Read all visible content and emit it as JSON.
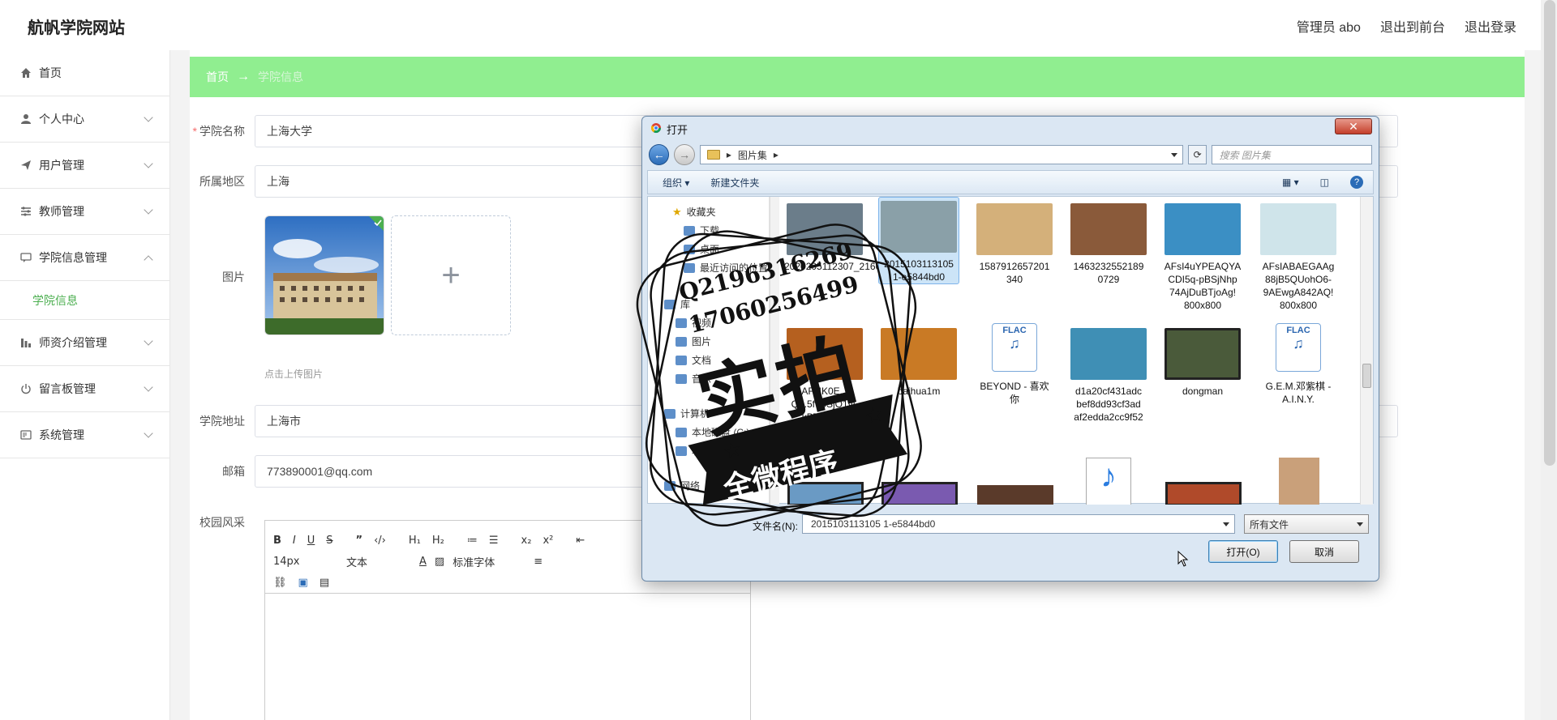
{
  "header": {
    "site_title": "航帆学院网站",
    "admin": "管理员 abo",
    "to_front": "退出到前台",
    "logout": "退出登录"
  },
  "sidebar": {
    "items": [
      {
        "label": "首页",
        "icon": "home-icon"
      },
      {
        "label": "个人中心",
        "icon": "user-icon"
      },
      {
        "label": "用户管理",
        "icon": "send-icon"
      },
      {
        "label": "教师管理",
        "icon": "sliders-icon"
      },
      {
        "label": "学院信息管理",
        "icon": "chat-icon"
      },
      {
        "label": "学院信息",
        "icon": ""
      },
      {
        "label": "师资介绍管理",
        "icon": "bar-chart-icon"
      },
      {
        "label": "留言板管理",
        "icon": "power-icon"
      },
      {
        "label": "系统管理",
        "icon": "id-card-icon"
      }
    ]
  },
  "breadcrumb": {
    "home": "首页",
    "sep": "→",
    "current": "学院信息"
  },
  "form": {
    "name_label": "学院名称",
    "name_value": "上海大学",
    "region_label": "所属地区",
    "region_value": "上海",
    "image_label": "图片",
    "upload_hint": "点击上传图片",
    "address_label": "学院地址",
    "address_value": "上海市",
    "email_label": "邮箱",
    "email_value": "773890001@qq.com",
    "campus_label": "校园风采"
  },
  "editor": {
    "font_size": "14px",
    "block": "文本",
    "font_family": "标准字体"
  },
  "dialog": {
    "title": "打开",
    "path": "图片集",
    "search_placeholder": "搜索 图片集",
    "organize": "组织 ▾",
    "new_folder": "新建文件夹",
    "tree": [
      "收藏夹",
      "下载",
      "桌面",
      "最近访问的位置",
      "库",
      "视频",
      "图片",
      "文档",
      "音乐",
      "计算机",
      "本地磁盘 (C:)",
      "软件 (D:)",
      "网络"
    ],
    "files": [
      {
        "name": "2020205112307_21604",
        "color": "#6b7d8a"
      },
      {
        "name": "2015103113105 1-e5844bd0",
        "color": "#8aa0a8",
        "selected": true
      },
      {
        "name": "1587912657201 340",
        "color": "#d4b07a"
      },
      {
        "name": "1463232552189 0729",
        "color": "#8a5a3a"
      },
      {
        "name": "AFsI4uYPEAQYA CDI5q-pBSjNhp 74AjDuBTjoAg! 800x800",
        "color": "#3b8fc4"
      },
      {
        "name": "AFsIABAEGAAg 88jB5QUohO6- 9AEwgA842AQ! 800x800",
        "color": "#cfe4ea"
      },
      {
        "name": "AFsIK0E... Q...5fvBSjO1vL kBTDIAT...",
        "color": "#b5601f"
      },
      {
        "name": "baihua1m",
        "color": "#c97a25"
      },
      {
        "name": "BEYOND - 喜欢 你",
        "color": "flac"
      },
      {
        "name": "d1a20cf431adc bef8dd93cf3ad af2edda2cc9f52",
        "color": "#3f8fb5"
      },
      {
        "name": "dongman",
        "color": "#4a5a3a"
      },
      {
        "name": "G.E.M.邓紫棋 - A.I.N.Y.",
        "color": "flac"
      }
    ],
    "filename_label": "文件名(N):",
    "filename_value": "2015103113105 1-e5844bd0",
    "filetype": "所有文件",
    "open_btn": "打开(O)",
    "cancel_btn": "取消"
  },
  "watermark": {
    "qq": "Q2196316269",
    "phone": "17060256499",
    "big": "实拍",
    "banner": "全微程序"
  },
  "colors": {
    "accent": "#90ee90",
    "active": "#4caf50"
  }
}
